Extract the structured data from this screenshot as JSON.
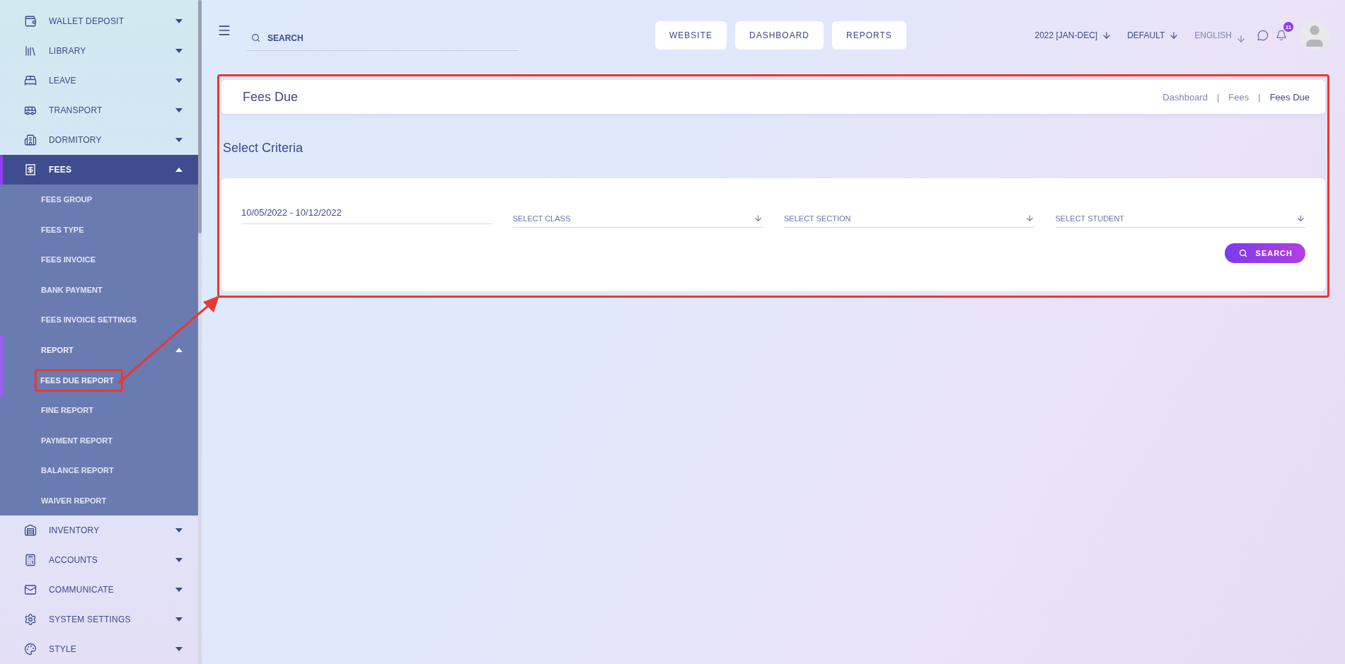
{
  "sidebar": {
    "items": [
      {
        "label": "WALLET DEPOSIT",
        "expanded": false,
        "selected": false
      },
      {
        "label": "LIBRARY",
        "expanded": false,
        "selected": false
      },
      {
        "label": "LEAVE",
        "expanded": false,
        "selected": false
      },
      {
        "label": "TRANSPORT",
        "expanded": false,
        "selected": false
      },
      {
        "label": "DORMITORY",
        "expanded": false,
        "selected": false
      },
      {
        "label": "FEES",
        "expanded": true,
        "selected": true,
        "children": [
          {
            "label": "FEES GROUP",
            "selected": false
          },
          {
            "label": "FEES TYPE",
            "selected": false
          },
          {
            "label": "FEES INVOICE",
            "selected": false
          },
          {
            "label": "BANK PAYMENT",
            "selected": false
          },
          {
            "label": "FEES INVOICE SETTINGS",
            "selected": false
          },
          {
            "label": "REPORT",
            "selected": true,
            "expanded": true,
            "children": [
              {
                "label": "FEES DUE REPORT",
                "selected": true
              },
              {
                "label": "FINE REPORT",
                "selected": false
              },
              {
                "label": "PAYMENT REPORT",
                "selected": false
              },
              {
                "label": "BALANCE REPORT",
                "selected": false
              },
              {
                "label": "WAIVER REPORT",
                "selected": false
              }
            ]
          }
        ]
      },
      {
        "label": "INVENTORY",
        "expanded": false,
        "selected": false
      },
      {
        "label": "ACCOUNTS",
        "expanded": false,
        "selected": false
      },
      {
        "label": "COMMUNICATE",
        "expanded": false,
        "selected": false
      },
      {
        "label": "SYSTEM SETTINGS",
        "expanded": false,
        "selected": false
      },
      {
        "label": "STYLE",
        "expanded": false,
        "selected": false
      }
    ]
  },
  "topbar": {
    "search": {
      "placeholder": "SEARCH"
    },
    "buttons": [
      "WEBSITE",
      "DASHBOARD",
      "REPORTS"
    ],
    "session": "2022 [JAN-DEC]",
    "theme": "DEFAULT",
    "language": "ENGLISH",
    "notifications": "11"
  },
  "page": {
    "title": "Fees Due",
    "breadcrumb_separator": "|",
    "breadcrumb": [
      {
        "label": "Dashboard",
        "selected": false
      },
      {
        "label": "Fees",
        "selected": false
      },
      {
        "label": "Fees Due",
        "selected": true
      }
    ]
  },
  "criteria": {
    "title": "Select Criteria",
    "date_range": "10/05/2022 - 10/12/2022",
    "selects": [
      {
        "placeholder": "SELECT CLASS"
      },
      {
        "placeholder": "SELECT SECTION"
      },
      {
        "placeholder": "SELECT STUDENT"
      }
    ],
    "button": "SEARCH"
  }
}
